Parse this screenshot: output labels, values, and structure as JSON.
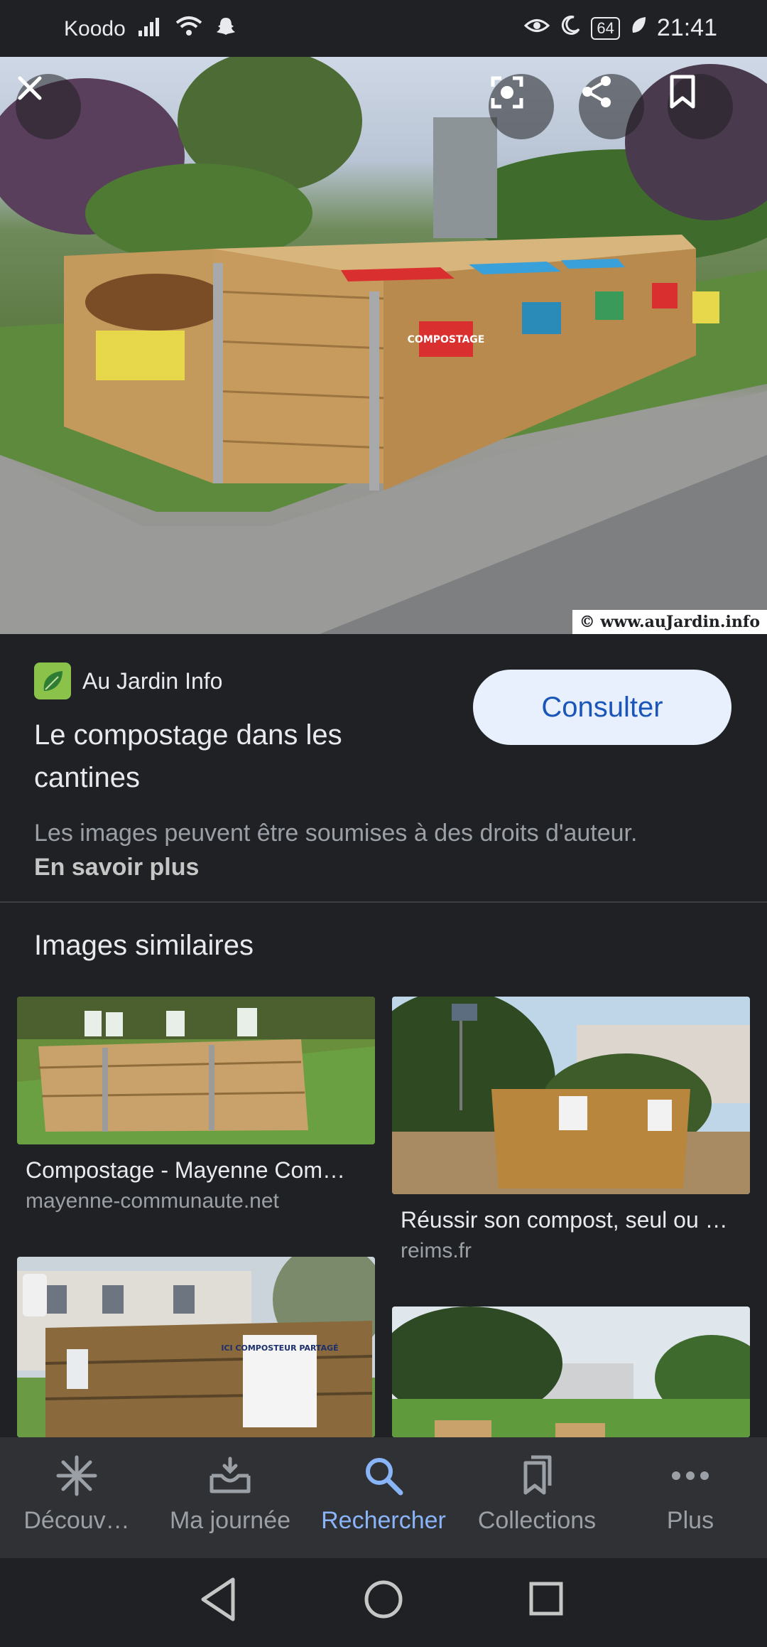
{
  "status_bar": {
    "carrier": "Koodo",
    "battery": "64",
    "time": "21:41"
  },
  "hero": {
    "credit": "© www.auJardin.info",
    "sign_text": "COMPOSTAGE"
  },
  "result": {
    "source_name": "Au Jardin Info",
    "title": "Le compostage dans les cantines",
    "consult_label": "Consulter",
    "rights_text": "Les images peuvent être soumises à des droits d'auteur.",
    "rights_link": "En savoir plus"
  },
  "similar": {
    "heading": "Images similaires",
    "items": [
      {
        "title": "Compostage - Mayenne Com…",
        "domain": "mayenne-communaute.net"
      },
      {
        "title": "Réussir son compost, seul ou …",
        "domain": "reims.fr"
      },
      {
        "sign": "ICI COMPOSTEUR PARTAGÉ"
      }
    ]
  },
  "bottom_nav": {
    "items": [
      {
        "label": "Découv…",
        "icon": "asterisk-icon"
      },
      {
        "label": "Ma journée",
        "icon": "inbox-tray-icon"
      },
      {
        "label": "Rechercher",
        "icon": "search-icon",
        "active": true
      },
      {
        "label": "Collections",
        "icon": "bookmarks-icon"
      },
      {
        "label": "Plus",
        "icon": "more-dots-icon"
      }
    ]
  },
  "colors": {
    "background": "#202124",
    "accent": "#8ab4f8",
    "button_bg": "#e8f0fe",
    "button_text": "#1a55b8"
  }
}
